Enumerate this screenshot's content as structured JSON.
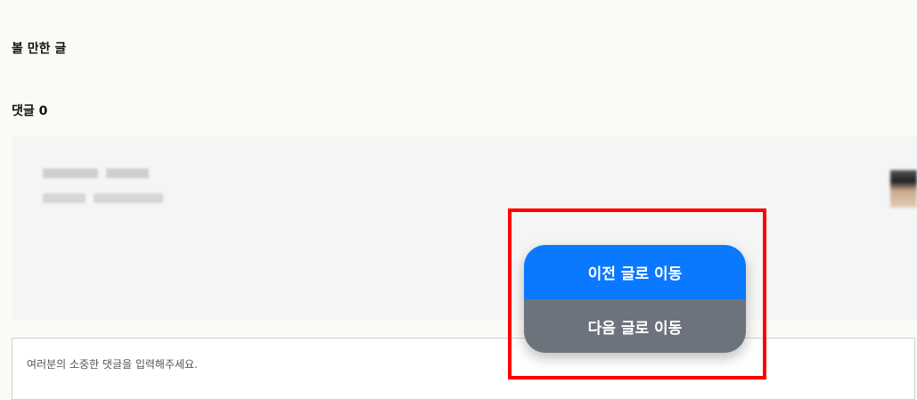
{
  "sections": {
    "recommended_title": "볼 만한 글",
    "comments_title": "댓글 0"
  },
  "comment_input": {
    "placeholder": "여러분의 소중한 댓글을 입력해주세요."
  },
  "navigation": {
    "prev_label": "이전 글로 이동",
    "next_label": "다음 글로 이동"
  },
  "colors": {
    "prev_button": "#0a78ff",
    "next_button": "#6c737c",
    "highlight_border": "#ff0000"
  }
}
